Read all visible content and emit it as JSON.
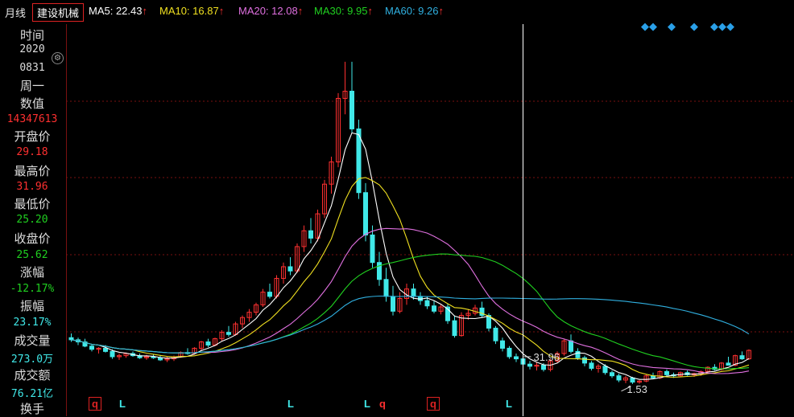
{
  "header": {
    "period": "月线",
    "stock_name": "建设机械",
    "ma": [
      {
        "label": "MA5: 22.43",
        "arrow": "↑",
        "color": "#ffffff"
      },
      {
        "label": "MA10: 16.87",
        "arrow": "↑",
        "color": "#f0e020"
      },
      {
        "label": "MA20: 12.08",
        "arrow": "↑",
        "color": "#e070e0"
      },
      {
        "label": "MA30: 9.95",
        "arrow": "↑",
        "color": "#20d020"
      },
      {
        "label": "MA60: 9.26",
        "arrow": "↑",
        "color": "#30b0e0"
      }
    ]
  },
  "info_panel": {
    "time_label": "时间",
    "year": "2020",
    "date": "0831",
    "weekday": "周一",
    "value_label": "数值",
    "value": "14347613",
    "open_label": "开盘价",
    "open": "29.18",
    "high_label": "最高价",
    "high": "31.96",
    "low_label": "最低价",
    "low": "25.20",
    "close_label": "收盘价",
    "close": "25.62",
    "change_label": "涨幅",
    "change": "-12.17%",
    "amplitude_label": "振幅",
    "amplitude": "23.17%",
    "volume_label": "成交量",
    "volume": "273.0万",
    "turnover_label": "成交额",
    "turnover": "76.21亿",
    "handchange_label": "换手"
  },
  "colors": {
    "up": "#ff3030",
    "down": "#40e8e8",
    "grid": "#7a1010",
    "crosshair": "#ffffff"
  },
  "chart_data": {
    "type": "candlestick",
    "ylim": [
      0,
      34
    ],
    "annotations": [
      {
        "text": "31.96",
        "kind": "high"
      },
      {
        "text": "1.53",
        "kind": "low"
      }
    ],
    "markers": [
      "q",
      "L",
      "L",
      "L",
      "q",
      "q",
      "L"
    ],
    "crosshair_index": 66,
    "candles": [
      [
        5.9,
        6.3,
        5.5,
        5.7
      ],
      [
        5.7,
        5.9,
        5.2,
        5.5
      ],
      [
        5.5,
        5.8,
        5.0,
        5.1
      ],
      [
        5.1,
        5.3,
        4.6,
        4.8
      ],
      [
        4.8,
        5.0,
        4.4,
        4.9
      ],
      [
        4.9,
        5.2,
        4.5,
        4.6
      ],
      [
        4.6,
        4.8,
        3.9,
        4.1
      ],
      [
        4.1,
        4.4,
        3.8,
        4.2
      ],
      [
        4.2,
        4.5,
        4.0,
        4.4
      ],
      [
        4.4,
        4.6,
        4.1,
        4.2
      ],
      [
        4.2,
        4.4,
        3.9,
        4.0
      ],
      [
        4.0,
        4.3,
        3.8,
        4.1
      ],
      [
        4.1,
        4.3,
        3.9,
        4.0
      ],
      [
        4.0,
        4.2,
        3.7,
        3.8
      ],
      [
        3.8,
        4.1,
        3.6,
        3.9
      ],
      [
        3.9,
        4.2,
        3.7,
        4.1
      ],
      [
        4.1,
        4.6,
        4.0,
        4.5
      ],
      [
        4.5,
        4.9,
        4.3,
        4.4
      ],
      [
        4.4,
        5.0,
        4.3,
        4.9
      ],
      [
        4.9,
        5.6,
        4.7,
        5.5
      ],
      [
        5.5,
        5.8,
        5.0,
        5.2
      ],
      [
        5.2,
        5.9,
        5.1,
        5.8
      ],
      [
        5.8,
        6.6,
        5.6,
        6.4
      ],
      [
        6.4,
        7.0,
        6.0,
        6.2
      ],
      [
        6.2,
        7.4,
        6.1,
        7.2
      ],
      [
        7.2,
        8.0,
        6.8,
        7.8
      ],
      [
        7.8,
        8.6,
        7.4,
        8.3
      ],
      [
        8.3,
        9.2,
        8.0,
        9.0
      ],
      [
        9.0,
        10.5,
        8.8,
        10.2
      ],
      [
        10.2,
        11.0,
        9.6,
        9.8
      ],
      [
        9.8,
        11.8,
        9.6,
        11.5
      ],
      [
        11.5,
        13.0,
        11.0,
        12.6
      ],
      [
        12.6,
        13.5,
        11.8,
        12.2
      ],
      [
        12.2,
        14.8,
        12.0,
        14.5
      ],
      [
        14.5,
        16.5,
        14.0,
        16.0
      ],
      [
        16.0,
        17.2,
        14.8,
        15.3
      ],
      [
        15.3,
        18.0,
        15.0,
        17.6
      ],
      [
        17.6,
        20.8,
        17.2,
        20.4
      ],
      [
        20.4,
        23.0,
        19.5,
        22.5
      ],
      [
        22.5,
        29.0,
        22.0,
        28.5
      ],
      [
        28.5,
        31.96,
        27.0,
        29.18
      ],
      [
        29.18,
        31.96,
        25.2,
        25.62
      ],
      [
        25.62,
        26.5,
        19.0,
        19.6
      ],
      [
        19.6,
        20.5,
        15.0,
        15.6
      ],
      [
        15.6,
        16.5,
        12.5,
        13.0
      ],
      [
        13.0,
        14.0,
        10.8,
        11.4
      ],
      [
        11.4,
        12.5,
        9.3,
        9.8
      ],
      [
        9.8,
        10.8,
        8.0,
        8.4
      ],
      [
        8.4,
        10.2,
        8.2,
        9.6
      ],
      [
        9.6,
        11.0,
        9.0,
        10.5
      ],
      [
        10.5,
        11.0,
        9.5,
        9.8
      ],
      [
        9.8,
        10.2,
        9.0,
        9.4
      ],
      [
        9.4,
        9.8,
        8.6,
        8.9
      ],
      [
        8.9,
        9.4,
        8.2,
        8.4
      ],
      [
        8.4,
        9.0,
        8.1,
        8.8
      ],
      [
        8.8,
        9.1,
        7.2,
        7.5
      ],
      [
        7.5,
        8.0,
        5.9,
        6.1
      ],
      [
        6.1,
        8.3,
        6.0,
        8.0
      ],
      [
        8.0,
        8.6,
        7.6,
        8.2
      ],
      [
        8.2,
        9.0,
        8.0,
        8.7
      ],
      [
        8.7,
        9.3,
        7.8,
        8.0
      ],
      [
        8.0,
        8.2,
        6.5,
        6.8
      ],
      [
        6.8,
        7.0,
        5.3,
        5.6
      ],
      [
        5.6,
        5.9,
        4.6,
        4.9
      ],
      [
        4.9,
        5.1,
        3.9,
        4.1
      ],
      [
        4.1,
        4.4,
        3.6,
        3.9
      ],
      [
        3.9,
        4.1,
        3.1,
        3.4
      ],
      [
        3.4,
        3.7,
        2.9,
        3.2
      ],
      [
        3.2,
        3.6,
        2.8,
        3.3
      ],
      [
        3.3,
        3.5,
        2.7,
        2.9
      ],
      [
        2.9,
        3.9,
        2.7,
        3.7
      ],
      [
        3.7,
        4.6,
        3.5,
        4.4
      ],
      [
        4.4,
        5.8,
        4.2,
        5.6
      ],
      [
        5.6,
        6.2,
        4.4,
        4.6
      ],
      [
        4.6,
        4.9,
        3.8,
        4.0
      ],
      [
        4.0,
        4.2,
        3.2,
        3.5
      ],
      [
        3.5,
        3.7,
        2.8,
        3.0
      ],
      [
        3.0,
        3.4,
        2.6,
        3.2
      ],
      [
        3.2,
        3.4,
        2.4,
        2.6
      ],
      [
        2.6,
        2.8,
        2.1,
        2.3
      ],
      [
        2.3,
        2.5,
        1.7,
        1.9
      ],
      [
        1.9,
        2.3,
        1.6,
        2.1
      ],
      [
        2.1,
        2.2,
        1.53,
        1.7
      ],
      [
        1.7,
        1.9,
        1.55,
        1.8
      ],
      [
        1.8,
        2.4,
        1.7,
        2.3
      ],
      [
        2.3,
        2.6,
        2.0,
        2.1
      ],
      [
        2.1,
        2.8,
        2.0,
        2.7
      ],
      [
        2.7,
        2.9,
        2.2,
        2.4
      ],
      [
        2.4,
        2.6,
        2.1,
        2.3
      ],
      [
        2.3,
        2.7,
        2.2,
        2.6
      ],
      [
        2.6,
        2.8,
        2.3,
        2.4
      ],
      [
        2.4,
        2.6,
        2.2,
        2.5
      ],
      [
        2.5,
        2.8,
        2.3,
        2.7
      ],
      [
        2.7,
        3.2,
        2.6,
        3.1
      ],
      [
        3.1,
        3.4,
        2.8,
        2.9
      ],
      [
        2.9,
        3.6,
        2.8,
        3.5
      ],
      [
        3.5,
        4.1,
        3.3,
        3.3
      ],
      [
        3.3,
        4.3,
        3.2,
        4.2
      ],
      [
        4.2,
        4.6,
        3.8,
        3.9
      ],
      [
        3.9,
        4.8,
        3.8,
        4.7
      ]
    ]
  }
}
